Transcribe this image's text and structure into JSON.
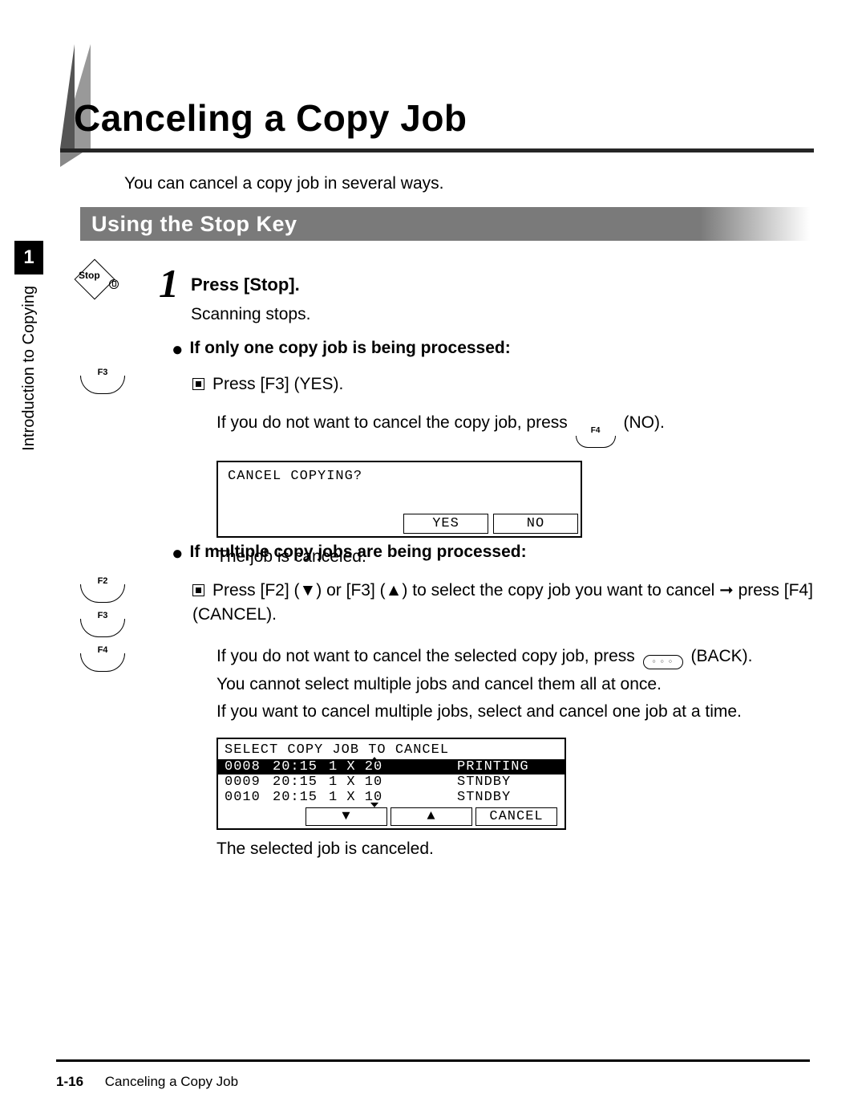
{
  "sidebar": {
    "chapter": "1",
    "label": "Introduction to Copying"
  },
  "title": "Canceling a Copy Job",
  "intro": "You can cancel a copy job in several ways.",
  "section": "Using the Stop Key",
  "keys": {
    "stop": "Stop",
    "f2": "F2",
    "f3": "F3",
    "f4": "F4"
  },
  "step": {
    "num": "1",
    "head": "Press [Stop].",
    "body": "Scanning stops."
  },
  "case1": {
    "head": "If only one copy job is being processed:",
    "item": "Press [F3] (YES).",
    "note_a": "If you do not want to cancel the copy job, press ",
    "note_b": " (NO).",
    "lcd_msg": "CANCEL COPYING?",
    "yes": "YES",
    "no": "NO",
    "concl": "The job is canceled."
  },
  "case2": {
    "head": "If multiple copy jobs are being processed:",
    "item": "Press [F2] (▼) or [F3] (▲) to select the copy job you want to cancel ➞ press [F4] (CANCEL).",
    "note1": "If you do not want to cancel the selected copy job, press ",
    "note1b": " (BACK).",
    "note2": "You cannot select multiple jobs and cancel them all at once.",
    "note3": "If you want to cancel multiple jobs, select and cancel one job at a time.",
    "lcd_title": "SELECT COPY JOB TO CANCEL",
    "rows": [
      {
        "id": "0008",
        "time": "20:15",
        "qty": "1 X 20",
        "status": "PRINTING"
      },
      {
        "id": "0009",
        "time": "20:15",
        "qty": "1 X 10",
        "status": "STNDBY"
      },
      {
        "id": "0010",
        "time": "20:15",
        "qty": "1 X 10",
        "status": "STNDBY"
      }
    ],
    "down": "▼",
    "up": "▲",
    "cancel": "CANCEL",
    "concl": "The selected job is canceled."
  },
  "footer": {
    "page": "1-16",
    "title": "Canceling a Copy Job"
  }
}
